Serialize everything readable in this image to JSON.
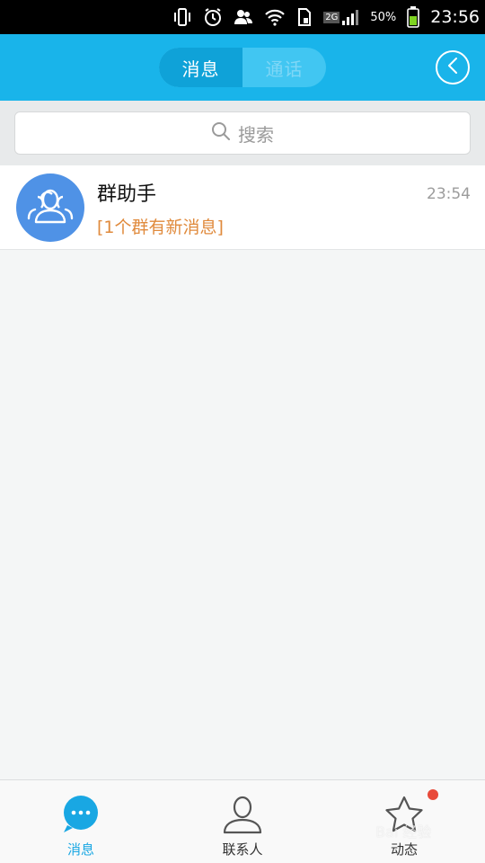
{
  "status_bar": {
    "network": "2G",
    "battery_percent": "50%",
    "time": "23:56",
    "icons": [
      "vibrate-icon",
      "alarm-icon",
      "contacts-sync-icon",
      "wifi-icon",
      "sim-icon",
      "signal-icon",
      "battery-icon"
    ]
  },
  "header": {
    "tabs": [
      {
        "label": "消息",
        "active": true
      },
      {
        "label": "通话",
        "active": false
      }
    ],
    "back_icon": "chevron-left-circle-icon"
  },
  "search": {
    "placeholder": "搜索",
    "icon": "search-icon"
  },
  "messages": [
    {
      "name": "群助手",
      "preview": "[1个群有新消息]",
      "time": "23:54",
      "avatar_icon": "group-icon"
    }
  ],
  "bottom_nav": {
    "items": [
      {
        "label": "消息",
        "icon": "chat-bubble-icon",
        "active": true
      },
      {
        "label": "联系人",
        "icon": "person-icon",
        "active": false
      },
      {
        "label": "动态",
        "icon": "star-icon",
        "active": false,
        "badge": true
      }
    ]
  },
  "watermark": "Bai 经验",
  "colors": {
    "header_bg": "#19b4ea",
    "active_tab": "#0fa2d8",
    "avatar_bg": "#4f92e6",
    "preview_text": "#e08a3c",
    "badge": "#e84a3a"
  }
}
